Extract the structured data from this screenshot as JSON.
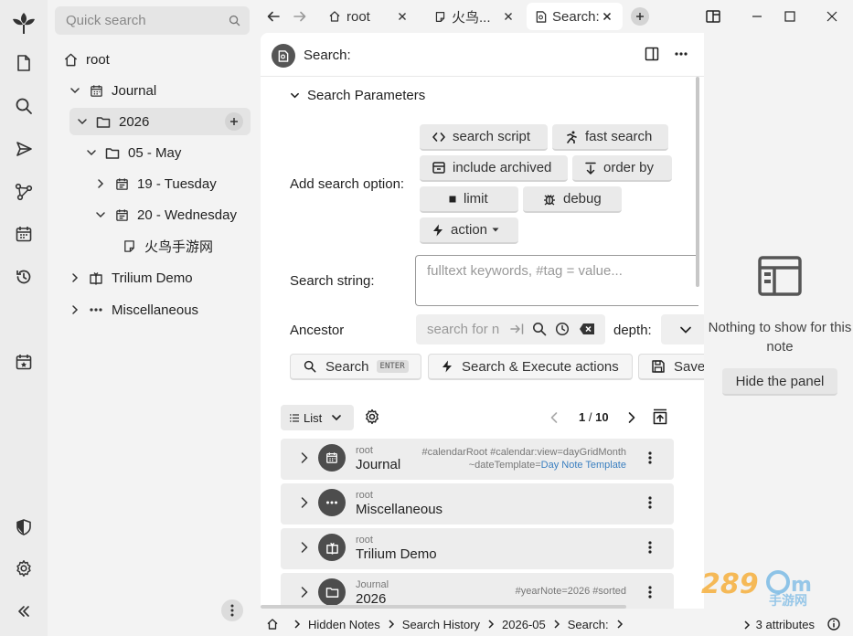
{
  "left_pane": {
    "quick_search_placeholder": "Quick search",
    "tree": [
      {
        "label": "root"
      },
      {
        "label": "Journal"
      },
      {
        "label": "2026"
      },
      {
        "label": "05 - May"
      },
      {
        "label": "19 - Tuesday"
      },
      {
        "label": "20 - Wednesday"
      },
      {
        "label": "火鸟手游网"
      },
      {
        "label": "Trilium Demo"
      },
      {
        "label": "Miscellaneous"
      }
    ]
  },
  "tabs": [
    {
      "label": "root"
    },
    {
      "label": "火鸟..."
    },
    {
      "label": "Search:"
    }
  ],
  "note": {
    "title": "Search:",
    "search_parameters_label": "Search Parameters",
    "add_search_option_label": "Add search option:",
    "options": {
      "search_script": "search script",
      "fast_search": "fast search",
      "include_archived": "include archived",
      "order_by": "order by",
      "limit": "limit",
      "debug": "debug",
      "action": "action"
    },
    "search_string_label": "Search string:",
    "search_string_placeholder": "fulltext keywords, #tag = value...",
    "ancestor_label": "Ancestor",
    "ancestor_placeholder": "search for n",
    "depth_label": "depth:",
    "buttons": {
      "search": "Search",
      "search_shortcut": "ENTER",
      "search_execute": "Search & Execute actions",
      "save": "Save"
    },
    "view_mode": "List",
    "pagination": {
      "current": "1",
      "separator": "/",
      "total": "10"
    },
    "results": [
      {
        "path": "root",
        "title": "Journal",
        "attrs": "#calendarRoot #calendar:view=dayGridMonth",
        "attrs2_prefix": "~dateTemplate=",
        "attrs2_link": "Day Note Template",
        "icon": "calendar-icon"
      },
      {
        "path": "root",
        "title": "Miscellaneous",
        "attrs": "",
        "icon": "dots-icon"
      },
      {
        "path": "root",
        "title": "Trilium Demo",
        "attrs": "",
        "icon": "book-icon"
      },
      {
        "path": "Journal",
        "title": "2026",
        "attrs": "#yearNote=2026 #sorted",
        "icon": "folder-icon"
      }
    ]
  },
  "right_pane": {
    "empty_text": "Nothing to show for this note",
    "hide_button": "Hide the panel"
  },
  "status_bar": {
    "breadcrumbs": [
      "Hidden Notes",
      "Search History",
      "2026-05",
      "Search:"
    ],
    "attributes": "3 attributes"
  },
  "colors": {
    "accent_link": "#3a7fc0",
    "icon_dark": "#4d4d4d"
  }
}
